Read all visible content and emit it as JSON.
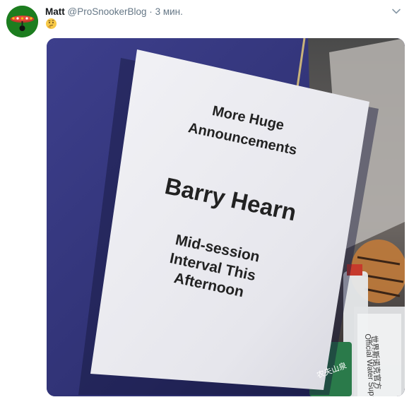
{
  "tweet": {
    "author_name": "Matt",
    "handle": "@ProSnookerBlog",
    "separator": "·",
    "time": "3 мин.",
    "emoji_icon": "thinking-face-icon"
  },
  "photo": {
    "sign_line1": "More Huge",
    "sign_line2": "Announcements",
    "sign_headline": "Barry Hearn",
    "sign_line3": "Mid-session",
    "sign_line4": "Interval This",
    "sign_line5": "Afternoon",
    "bottle_label_top": "世界斯诺克官方",
    "bottle_label_side": "Official Water Supplier of",
    "bottle_label_bottom": "农夫山泉"
  }
}
